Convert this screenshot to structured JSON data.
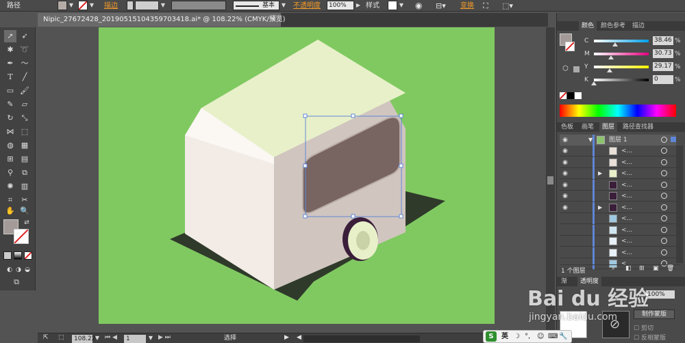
{
  "control_bar": {
    "object_type": "路径",
    "stroke_label": "描边",
    "stroke_style": "基本",
    "opacity_label": "不透明度",
    "opacity_value": "100%",
    "style_label": "样式",
    "transform_label": "变换"
  },
  "document": {
    "tab_title": "Nipic_27672428_20190515104359703418.ai* @ 108.22% (CMYK/预览)",
    "close_glyph": "✕"
  },
  "status_bar": {
    "zoom": "108.22",
    "page": "1",
    "tool_status": "选择"
  },
  "colors": {
    "artboard": "#80c961",
    "van_roof": "#e8f0c9",
    "van_side": "#d0c5bf",
    "van_front": "#f2ebe6",
    "window": "#786460",
    "shadow": "#2f3a2a",
    "wheel_outer": "#3a1e3a",
    "wheel_inner": "#e8f0c9",
    "selection": "#5f86d6",
    "accent_orange": "#f39b2a"
  },
  "color_panel": {
    "tabs": [
      "颜色",
      "颜色参考",
      "描边"
    ],
    "channels": [
      {
        "label": "C",
        "value": "38.46",
        "percent": 38.46,
        "gradient": "linear-gradient(to right,#fff,#00a0e9)"
      },
      {
        "label": "M",
        "value": "30.73",
        "percent": 30.73,
        "gradient": "linear-gradient(to right,#fff,#e4007f)"
      },
      {
        "label": "Y",
        "value": "29.17",
        "percent": 29.17,
        "gradient": "linear-gradient(to right,#fff,#fff100)"
      },
      {
        "label": "K",
        "value": "0",
        "percent": 0,
        "gradient": "linear-gradient(to right,#fff,#000)"
      }
    ],
    "pct_sign": "%"
  },
  "layers_panel": {
    "tabs": [
      "色板",
      "画笔",
      "图层",
      "路径查找器"
    ],
    "layer_title": "图层 1",
    "sublayer_label": "<...",
    "row_count": 12,
    "footer": "1 个图层"
  },
  "bottom_panel": {
    "tabs": [
      "渐",
      "透明度"
    ],
    "opacity": "100%",
    "mask_button": "制作蒙版",
    "clip": "剪切",
    "invert": "反相蒙版"
  },
  "ime": {
    "logo": "S",
    "lang": "英"
  },
  "watermark": {
    "brand": "Bai du 经验",
    "url": "jingyan.baidu.com"
  }
}
